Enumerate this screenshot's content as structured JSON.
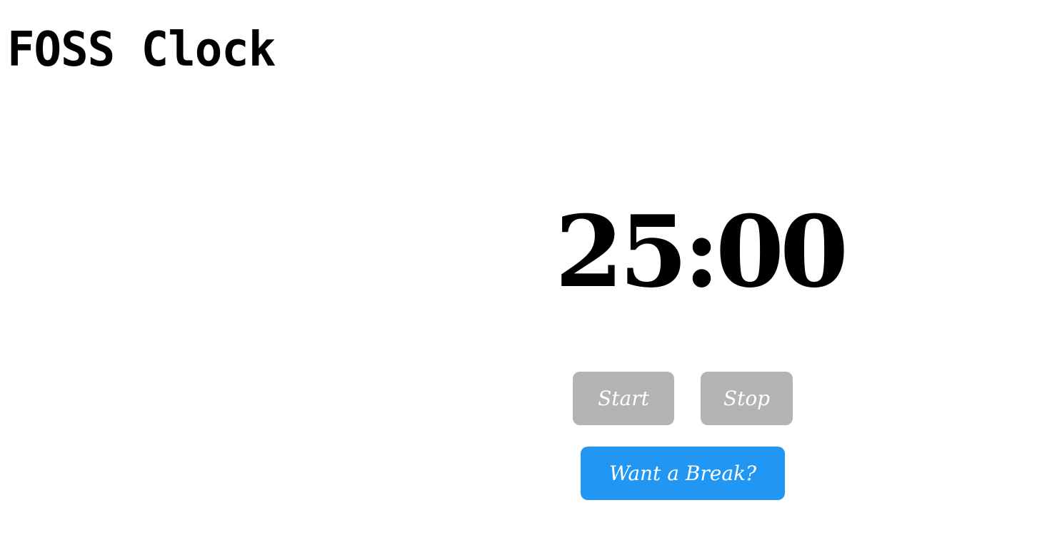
{
  "app": {
    "title": "FOSS Clock"
  },
  "timer": {
    "display": "25:00"
  },
  "controls": {
    "start_label": "Start",
    "stop_label": "Stop",
    "break_label": "Want a Break?"
  },
  "colors": {
    "disabled_button": "#b3b3b3",
    "break_button": "#2196f3",
    "text": "#000000",
    "button_text": "#ffffff"
  }
}
